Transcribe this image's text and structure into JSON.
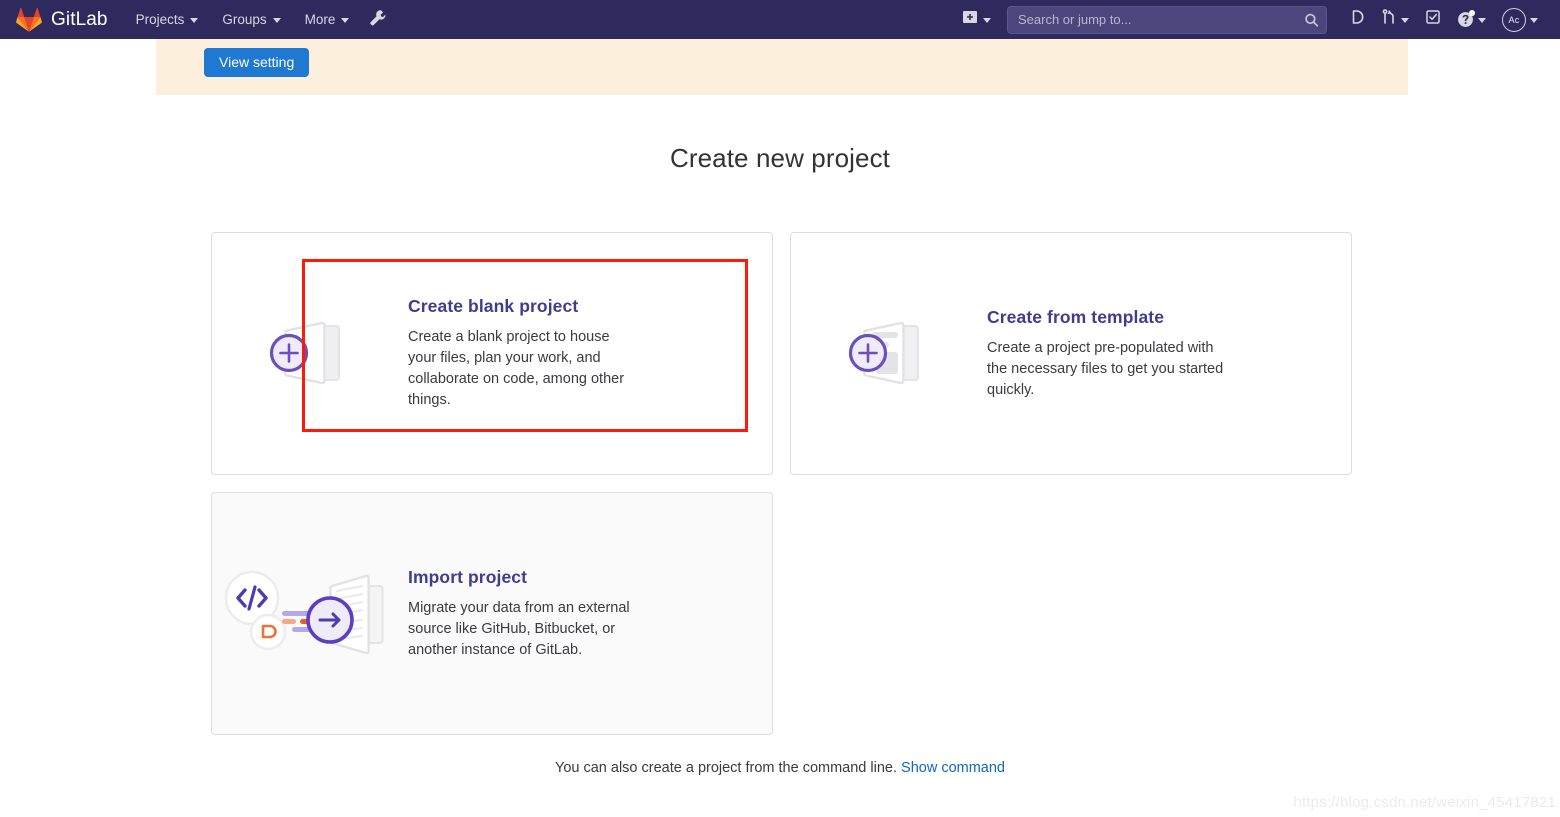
{
  "navbar": {
    "brand": "GitLab",
    "brand_logo_icon": "gitlab-fox-logo",
    "links": [
      {
        "label": "Projects",
        "icon": "chevron-down-icon"
      },
      {
        "label": "Groups",
        "icon": "chevron-down-icon"
      },
      {
        "label": "More",
        "icon": "chevron-down-icon"
      }
    ],
    "admin_icon": "wrench-icon",
    "create_new_icon": "plus-square-icon",
    "create_new_caret_icon": "chevron-down-icon",
    "search": {
      "placeholder": "Search or jump to...",
      "value": "",
      "icon": "search-icon"
    },
    "issues_icon": "issues-icon",
    "merge_requests_icon": "merge-request-icon",
    "merge_requests_caret_icon": "chevron-down-icon",
    "todos_icon": "todo-check-icon",
    "help_icon": "question-circle-icon",
    "help_caret_icon": "chevron-down-icon",
    "avatar_initials": "Ac",
    "avatar_caret_icon": "chevron-down-icon",
    "bg_color": "#2e2a5e"
  },
  "alert": {
    "button_label": "View setting",
    "bg_color": "#fcefdc",
    "button_color": "#1f78d1"
  },
  "main": {
    "title": "Create new project",
    "cards": [
      {
        "id": "create-blank-project",
        "title": "Create blank project",
        "description": "Create a blank project to house your files, plan your work, and collaborate on code, among other things.",
        "icon": "blank-project-folder-plus-icon",
        "highlighted": true,
        "highlight_color": "#fc1b09"
      },
      {
        "id": "create-from-template",
        "title": "Create from template",
        "description": "Create a project pre-populated with the necessary files to get you started quickly.",
        "icon": "template-project-folder-plus-icon",
        "highlighted": false
      },
      {
        "id": "import-project",
        "title": "Import project",
        "description": "Migrate your data from an external source like GitHub, Bitbucket, or another instance of GitLab.",
        "icon": "import-project-arrow-icon",
        "highlighted": false,
        "hovered": true
      }
    ],
    "command_line_note": "You can also create a project from the command line.",
    "command_line_link": "Show command"
  },
  "watermark": "https://blog.csdn.net/weixin_45417821",
  "theme": {
    "accent_purple": "#6b4fbb",
    "title_color": "#403c8e",
    "link_blue": "#1068bf"
  }
}
